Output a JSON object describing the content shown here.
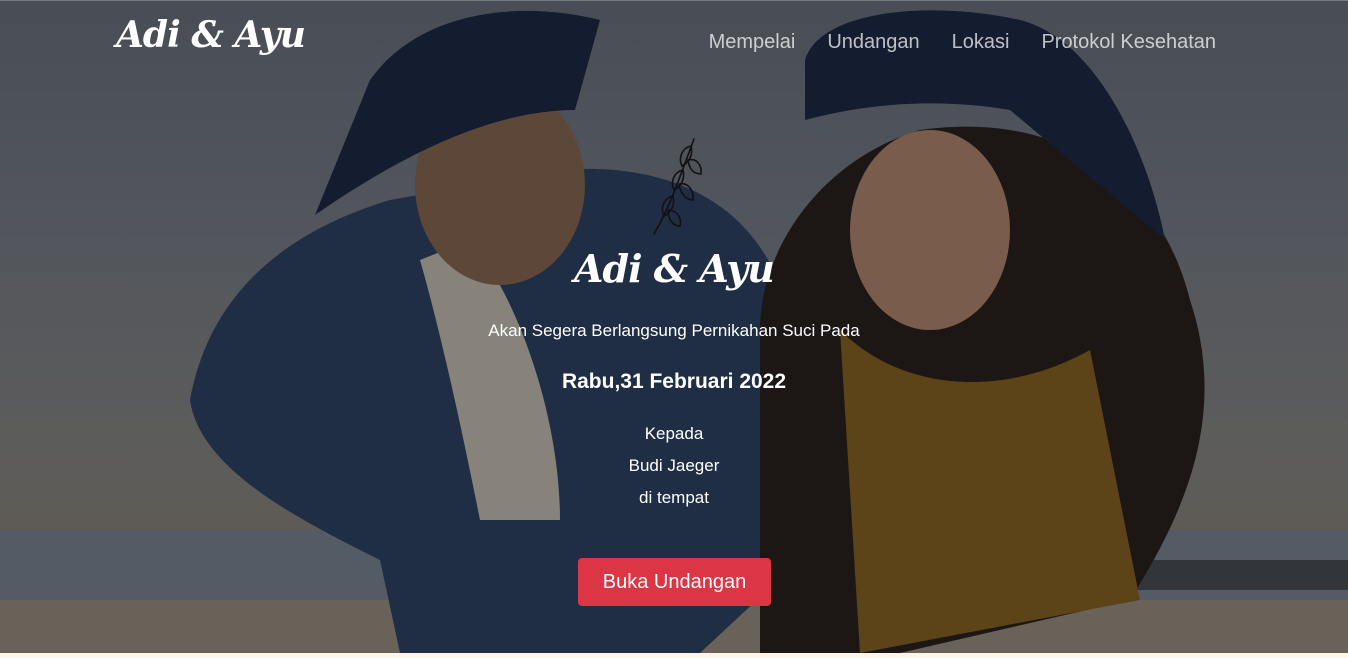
{
  "header": {
    "brand": "Adi & Ayu",
    "nav": [
      "Mempelai",
      "Undangan",
      "Lokasi",
      "Protokol Kesehatan"
    ]
  },
  "hero": {
    "couple_names": "Adi & Ayu",
    "subtitle": "Akan Segera Berlangsung Pernikahan Suci Pada",
    "date": "Rabu,31 Februari 2022",
    "to_label": "Kepada",
    "guest_name": "Budi Jaeger",
    "place": "di tempat",
    "open_button": "Buka Undangan"
  },
  "icons": {
    "hero_ornament": "leaf-branch-icon"
  },
  "colors": {
    "accent": "#dc3545",
    "overlay": "rgba(0,0,0,0.33)",
    "text": "#ffffff"
  }
}
